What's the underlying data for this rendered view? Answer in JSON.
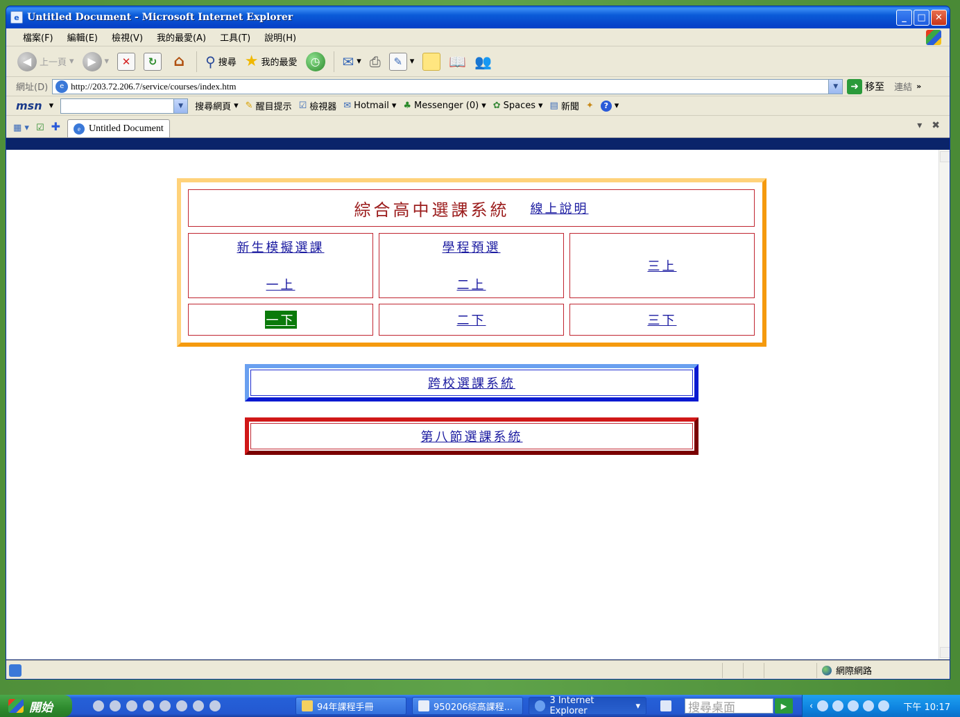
{
  "window": {
    "title": "Untitled Document - Microsoft Internet Explorer"
  },
  "menu": [
    "檔案(F)",
    "編輯(E)",
    "檢視(V)",
    "我的最愛(A)",
    "工具(T)",
    "說明(H)"
  ],
  "toolbar": {
    "back": "上一頁",
    "search": "搜尋",
    "favorites": "我的最愛"
  },
  "address": {
    "label": "網址(D)",
    "url": "http://203.72.206.7/service/courses/index.htm",
    "go": "移至",
    "links": "連結"
  },
  "msn": {
    "logo": "msn",
    "search_web": "搜尋網頁",
    "highlight": "醒目提示",
    "viewer": "檢視器",
    "hotmail": "Hotmail",
    "messenger": "Messenger (0)",
    "spaces": "Spaces",
    "news": "新聞"
  },
  "tab": {
    "title": "Untitled Document"
  },
  "page": {
    "system_title": "綜合高中選課系統",
    "help_link": "線上說明",
    "freshman_sim": "新生模擬選課",
    "program_pre": "學程預選",
    "g1_first": "一上",
    "g2_first": "二上",
    "g3_first": "三上",
    "g1_second": "一下",
    "g2_second": "二下",
    "g3_second": "三下",
    "cross_school": "跨校選課系統",
    "eighth_period": "第八節選課系統"
  },
  "status": {
    "zone": "網際網路"
  },
  "taskbar": {
    "start": "開始",
    "tasks": [
      "94年課程手冊",
      "950206綜高課程...",
      "3 Internet Explorer"
    ],
    "desk_search": "搜尋桌面",
    "clock": "下午 10:17"
  }
}
